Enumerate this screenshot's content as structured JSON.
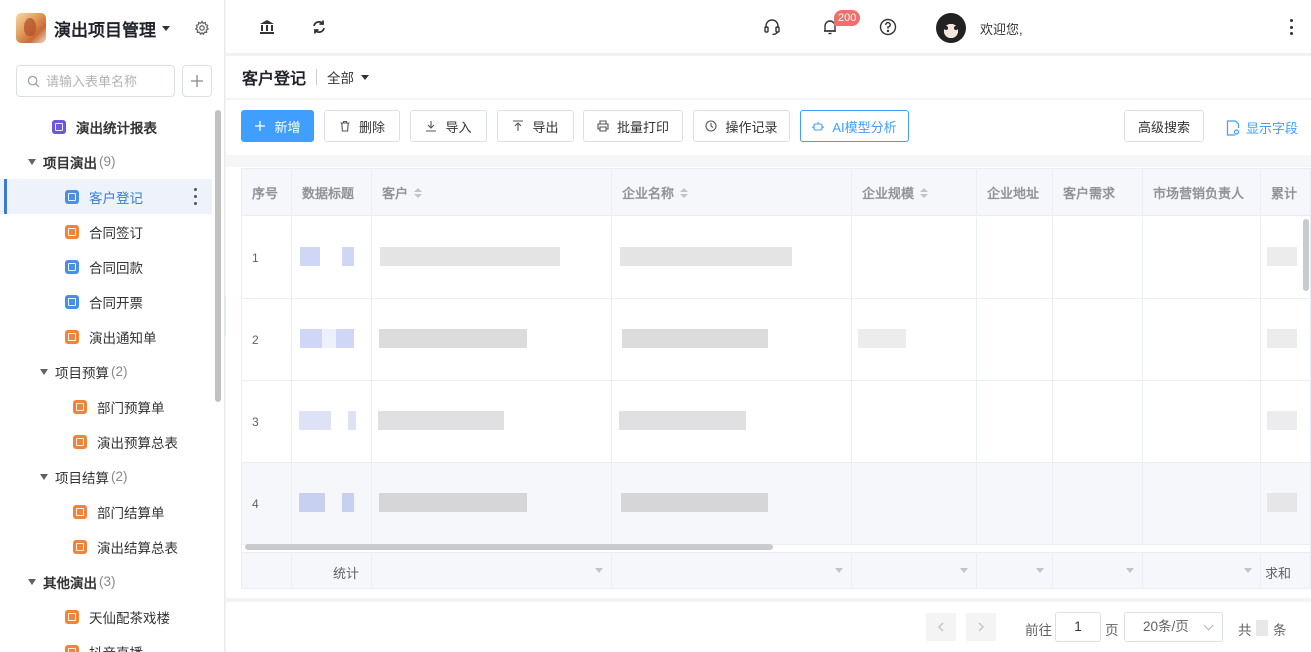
{
  "sidebar": {
    "app_title": "演出项目管理",
    "search_placeholder": "请输入表单名称",
    "items": [
      {
        "type": "form",
        "label": "演出统计报表",
        "color": "purple",
        "indent": 52,
        "bold": true
      },
      {
        "type": "group",
        "label": "项目演出",
        "count": "(9)",
        "indent": 28
      },
      {
        "type": "form",
        "label": "客户登记",
        "color": "blue",
        "indent": 65,
        "active": true
      },
      {
        "type": "form",
        "label": "合同签订",
        "color": "orange",
        "indent": 65
      },
      {
        "type": "form",
        "label": "合同回款",
        "color": "blue",
        "indent": 65
      },
      {
        "type": "form",
        "label": "合同开票",
        "color": "blue",
        "indent": 65
      },
      {
        "type": "form",
        "label": "演出通知单",
        "color": "orange",
        "indent": 65
      },
      {
        "type": "subgroup",
        "label": "项目预算",
        "count": "(2)",
        "indent": 40
      },
      {
        "type": "form",
        "label": "部门预算单",
        "color": "orange",
        "indent": 73
      },
      {
        "type": "form",
        "label": "演出预算总表",
        "color": "orange",
        "indent": 73
      },
      {
        "type": "subgroup",
        "label": "项目结算",
        "count": "(2)",
        "indent": 40
      },
      {
        "type": "form",
        "label": "部门结算单",
        "color": "orange",
        "indent": 73
      },
      {
        "type": "form",
        "label": "演出结算总表",
        "color": "orange",
        "indent": 73
      },
      {
        "type": "group",
        "label": "其他演出",
        "count": "(3)",
        "indent": 28
      },
      {
        "type": "form",
        "label": "天仙配茶戏楼",
        "color": "orange",
        "indent": 65
      },
      {
        "type": "form",
        "label": "抖音直播",
        "color": "orange",
        "indent": 65
      }
    ]
  },
  "topbar": {
    "notification_count": "200",
    "welcome": "欢迎您,",
    "icons": [
      "bank-icon",
      "refresh-icon",
      "headset-icon",
      "bell-icon",
      "help-icon"
    ]
  },
  "header": {
    "title": "客户登记",
    "filter": "全部"
  },
  "toolbar": {
    "new": "新增",
    "delete": "删除",
    "import": "导入",
    "export": "导出",
    "batch_print": "批量打印",
    "op_log": "操作记录",
    "ai_analysis": "AI模型分析",
    "advanced_search": "高级搜索",
    "show_fields": "显示字段"
  },
  "table": {
    "columns": [
      "序号",
      "数据标题",
      "客户",
      "企业名称",
      "企业规模",
      "企业地址",
      "客户需求",
      "市场营销负责人",
      "累计"
    ],
    "rows": [
      "1",
      "2",
      "3",
      "4"
    ],
    "footer_label": "统计",
    "footer_sum": "求和"
  },
  "pagination": {
    "goto": "前往",
    "page": "1",
    "page_unit": "页",
    "page_size": "20条/页",
    "total_prefix": "共",
    "total_suffix": "条"
  },
  "colors": {
    "primary": "#409eff",
    "active": "#3a7bd5",
    "badge": "#f56c6c",
    "orange": "#f0843a",
    "blue": "#4a90e2",
    "purple": "#6d58d8"
  }
}
